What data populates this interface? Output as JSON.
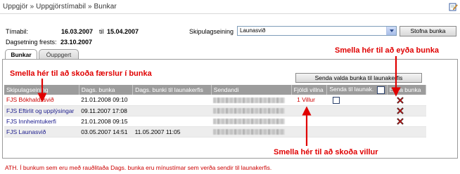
{
  "breadcrumb": "Uppgjör » Uppgjörstímabil » Bunkar",
  "period": {
    "label": "Tímabil:",
    "from": "16.03.2007",
    "to_word": "til",
    "to": "15.04.2007"
  },
  "deadline": {
    "label": "Dagsetning frests:",
    "value": "23.10.2007"
  },
  "planning_unit": {
    "label": "Skipulagseining",
    "selected": "Launasvið"
  },
  "buttons": {
    "create_batch": "Stofna bunka",
    "send_selected": "Senda valda bunka til launakerfis"
  },
  "tabs": [
    "Bunkar",
    "Óuppgert"
  ],
  "table": {
    "headers": [
      "Skipulagseining",
      "Dags. bunka",
      "Dags. bunki til launakerfis",
      "Sendandi",
      "Fjöldi villna",
      "Senda til launak.",
      "Eyða bunka"
    ],
    "rows": [
      {
        "unit": "FJS Bókhaldssvið",
        "date": "21.01.2008 09:10",
        "sent_date": "",
        "errors": "1 Villur",
        "unit_color": "#cc0000"
      },
      {
        "unit": "FJS Eftirlit og upplýsingar",
        "date": "09.11.2007 17:08",
        "sent_date": "",
        "errors": "",
        "unit_color": "#1a1a8c"
      },
      {
        "unit": "FJS Innheimtukerfi",
        "date": "21.01.2008 09:15",
        "sent_date": "",
        "errors": "",
        "unit_color": "#1a1a8c"
      },
      {
        "unit": "FJS Launasvið",
        "date": "03.05.2007 14:51",
        "sent_date": "11.05.2007 11:05",
        "errors": "",
        "unit_color": "#1a1a8c"
      }
    ]
  },
  "annotations": {
    "view_records": "Smella hér til að skoða færslur í bunka",
    "delete_batch": "Smella hér til að eyða bunka",
    "view_errors": "Smella hér til að skoða villur"
  },
  "footnote": "ATH. Í bunkum sem eru með rauðlitaða Dags. bunka eru mínustímar sem verða sendir til launakerfis.",
  "colors": {
    "accent_red": "#e00000",
    "header_gray": "#9c9c9c"
  }
}
